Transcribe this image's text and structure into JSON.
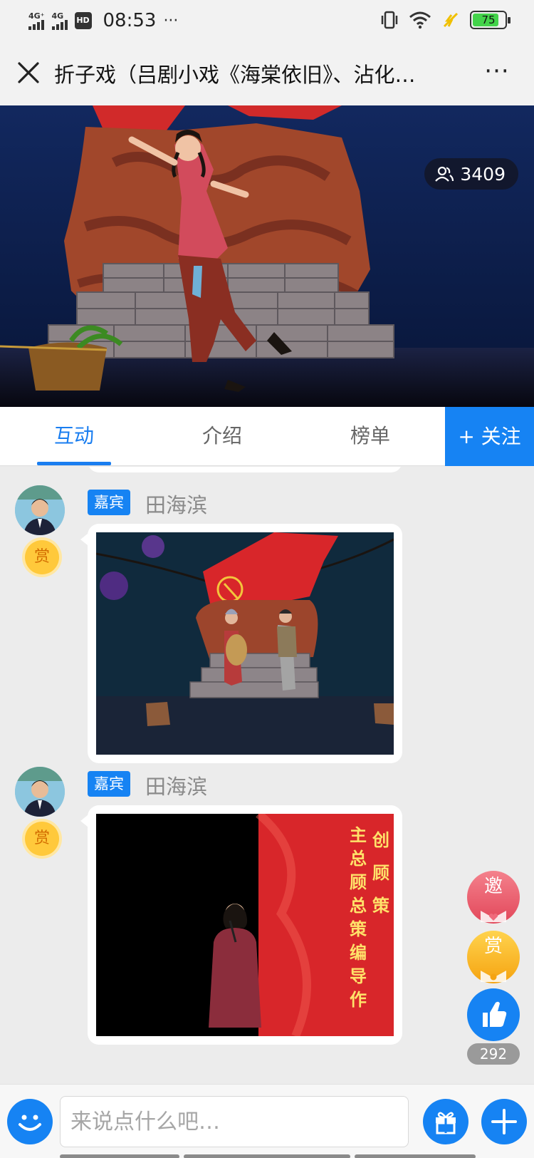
{
  "status_bar": {
    "net1": "4G⁺",
    "net2": "4G",
    "hd": "HD",
    "time": "08:53",
    "dots": "···",
    "battery": "75"
  },
  "header": {
    "title": "折子戏（吕剧小戏《海棠依旧》、沾化…",
    "more": "···"
  },
  "video": {
    "viewer_count": "3409"
  },
  "tabs": {
    "items": [
      {
        "label": "互动"
      },
      {
        "label": "介绍"
      },
      {
        "label": "榜单"
      }
    ],
    "follow": "+ 关注"
  },
  "feed": {
    "posts": [
      {
        "tag": "嘉宾",
        "author": "田海滨",
        "reward": "赏"
      },
      {
        "tag": "嘉宾",
        "author": "田海滨",
        "reward": "赏"
      }
    ],
    "banner_text_col1": "主总顾总策编导作",
    "banner_text_col2": "创顾策"
  },
  "floating": {
    "invite": "邀",
    "reward": "赏",
    "like_count": "292"
  },
  "input": {
    "placeholder": "来说点什么吧…"
  },
  "colors": {
    "accent": "#1683f3",
    "reward_gold": "#ffc93b",
    "invite_pink": "#e2475a",
    "stage_red": "#d8262a"
  }
}
